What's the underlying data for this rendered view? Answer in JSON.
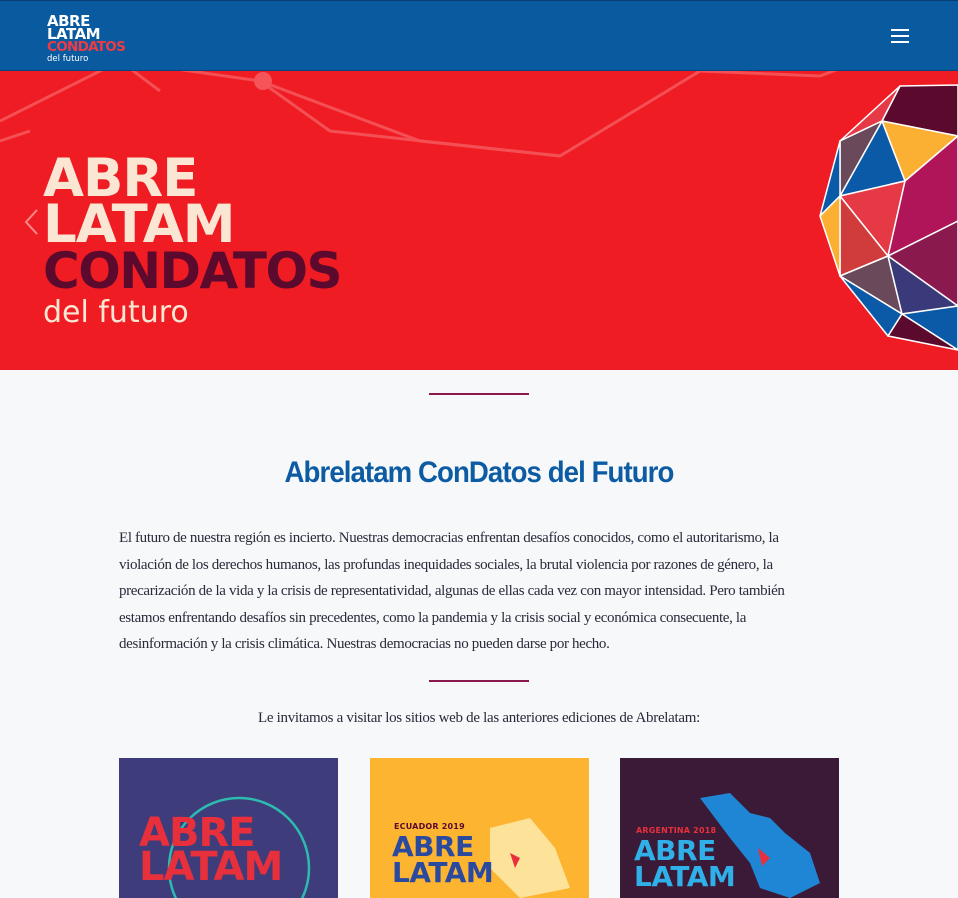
{
  "nav": {
    "logo": {
      "line1": "ABRE",
      "line2": "LATAM",
      "line3": "CONDATOS",
      "line4": "del futuro"
    },
    "menu_icon": "hamburger-icon"
  },
  "hero": {
    "line1": "ABRE",
    "line2": "LATAM",
    "line3": "CONDATOS",
    "line4": "del futuro",
    "prev_icon": "chevron-left-icon"
  },
  "main": {
    "title": "Abrelatam ConDatos del Futuro",
    "intro": "El futuro de nuestra región es incierto. Nuestras democracias enfrentan desafíos conocidos, como el autoritarismo, la violación de los derechos humanos, las profundas inequidades sociales, la brutal violencia por razones de género, la precarización de la vida y la crisis de representatividad, algunas de ellas cada vez con mayor intensidad. Pero también estamos enfrentando desafíos sin precedentes, como la pandemia y la crisis social y económica consecuente, la desinformación y la crisis climática. Nuestras democracias no pueden darse por hecho.",
    "invite": "Le invitamos a visitar los sitios web de las anteriores ediciones de Abrelatam:"
  },
  "editions": [
    {
      "edition": "",
      "line1": "ABRE",
      "line2": "LATAM"
    },
    {
      "edition": "ECUADOR 2019",
      "line1": "ABRE",
      "line2": "LATAM"
    },
    {
      "edition": "ARGENTINA 2018",
      "line1": "ABRE",
      "line2": "LATAM"
    }
  ],
  "colors": {
    "navbar": "#0a5aa0",
    "hero_red": "#ef1c23",
    "title_blue": "#0d5ca3",
    "divider": "#8a1a4e"
  }
}
